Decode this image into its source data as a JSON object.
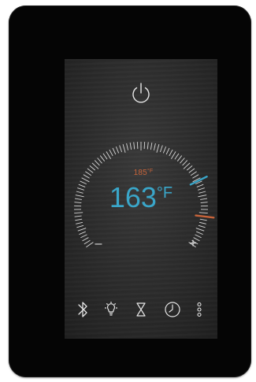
{
  "thermostat": {
    "setpoint_temp": "185",
    "setpoint_unit": "°F",
    "current_temp": "163",
    "current_unit": "°F",
    "decrease_label": "–",
    "increase_label": "+"
  },
  "icons": [
    "bluetooth-icon",
    "light-bulb-icon",
    "hourglass-icon",
    "clock-icon",
    "more-options-icon"
  ],
  "colors": {
    "device": "#050505",
    "screen": "#2e2e2e",
    "current_temp": "#3aa6c9",
    "setpoint_temp": "#c8643a",
    "tick": "#d8d8d8"
  }
}
